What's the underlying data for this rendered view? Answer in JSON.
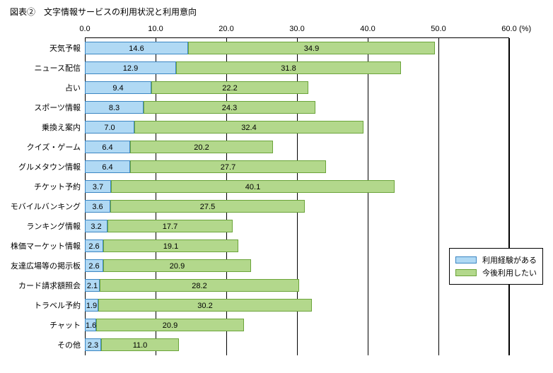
{
  "title": "図表②　文字情報サービスの利用状況と利用意向",
  "unit": "(%)",
  "axis_max": 60.0,
  "axis_ticks": [
    "0.0",
    "10.0",
    "20.0",
    "30.0",
    "40.0",
    "50.0",
    "60.0"
  ],
  "legend": {
    "s1": "利用経験がある",
    "s2": "今後利用したい"
  },
  "chart_data": {
    "type": "bar",
    "orientation": "horizontal",
    "stacked": true,
    "xlabel": "",
    "ylabel": "",
    "xlim": [
      0,
      60
    ],
    "categories": [
      "天気予報",
      "ニュース配信",
      "占い",
      "スポーツ情報",
      "乗換え案内",
      "クイズ・ゲーム",
      "グルメタウン情報",
      "チケット予約",
      "モバイルバンキング",
      "ランキング情報",
      "株価マーケット情報",
      "友達広場等の掲示板",
      "カード請求額照会",
      "トラベル予約",
      "チャット",
      "その他"
    ],
    "series": [
      {
        "name": "利用経験がある",
        "values": [
          14.6,
          12.9,
          9.4,
          8.3,
          7.0,
          6.4,
          6.4,
          3.7,
          3.6,
          3.2,
          2.6,
          2.6,
          2.1,
          1.9,
          1.6,
          2.3
        ]
      },
      {
        "name": "今後利用したい",
        "values": [
          34.9,
          31.8,
          22.2,
          24.3,
          32.4,
          20.2,
          27.7,
          40.1,
          27.5,
          17.7,
          19.1,
          20.9,
          28.2,
          30.2,
          20.9,
          11.0
        ]
      }
    ]
  }
}
